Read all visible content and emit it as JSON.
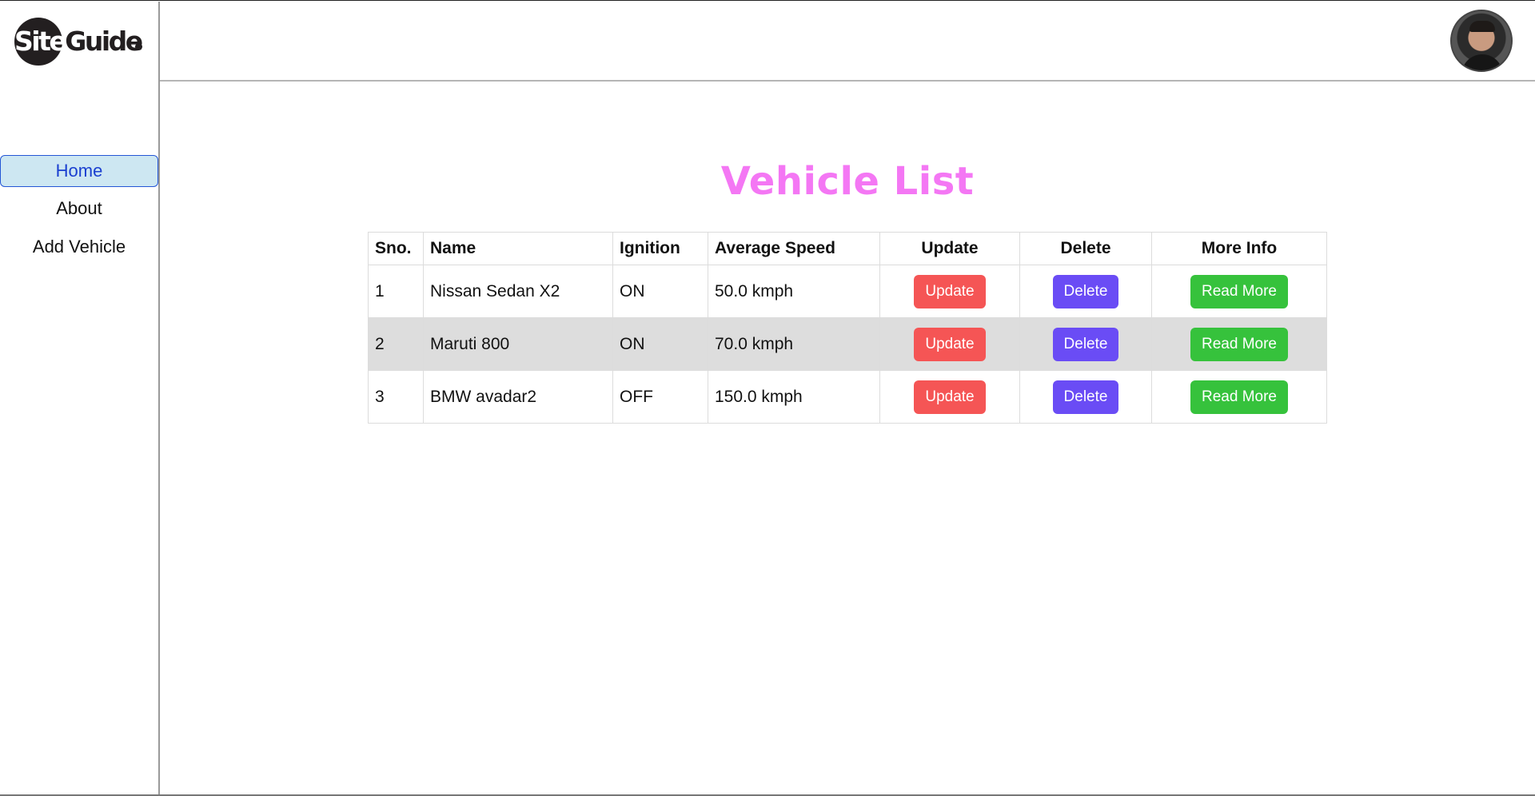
{
  "brand": {
    "logo_text_site": "Site",
    "logo_text_guide": "Guide"
  },
  "sidebar": {
    "items": [
      {
        "label": "Home",
        "active": true
      },
      {
        "label": "About",
        "active": false
      },
      {
        "label": "Add Vehicle",
        "active": false
      }
    ]
  },
  "header": {
    "avatar": "user-avatar"
  },
  "main": {
    "title": "Vehicle List",
    "table": {
      "columns": [
        "Sno.",
        "Name",
        "Ignition",
        "Average Speed",
        "Update",
        "Delete",
        "More Info"
      ],
      "rows": [
        {
          "sno": "1",
          "name": "Nissan Sedan X2",
          "ignition": "ON",
          "speed": "50.0 kmph",
          "update": "Update",
          "delete": "Delete",
          "more": "Read More"
        },
        {
          "sno": "2",
          "name": "Maruti 800",
          "ignition": "ON",
          "speed": "70.0 kmph",
          "update": "Update",
          "delete": "Delete",
          "more": "Read More"
        },
        {
          "sno": "3",
          "name": "BMW avadar2",
          "ignition": "OFF",
          "speed": "150.0 kmph",
          "update": "Update",
          "delete": "Delete",
          "more": "Read More"
        }
      ]
    }
  },
  "colors": {
    "title": "#f477f4",
    "update_button": "#f55555",
    "delete_button": "#6a4cf5",
    "more_button": "#36c23c",
    "active_nav_bg": "#cde7f2",
    "active_nav_text": "#1a3fd0",
    "striped_row": "#dddddd"
  }
}
